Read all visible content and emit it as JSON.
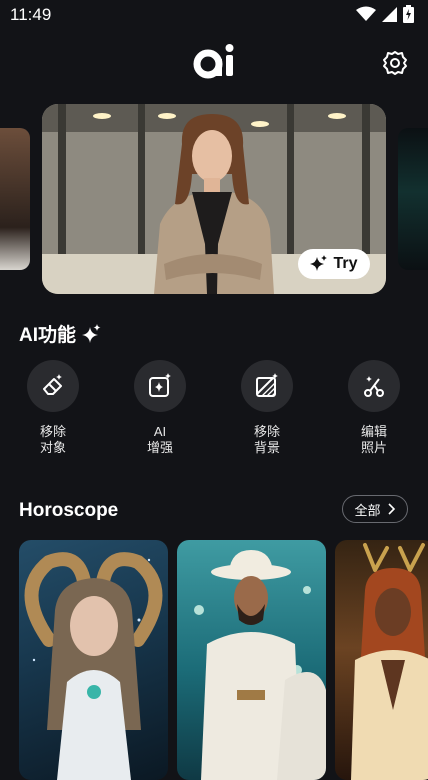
{
  "status_bar": {
    "time": "11:49"
  },
  "header": {
    "logo_text": "ai",
    "settings_icon": "gear-icon"
  },
  "banner": {
    "try_label": "Try"
  },
  "ai_features": {
    "title": "AI功能",
    "items": [
      {
        "label": "移除\n对象",
        "icon": "eraser-sparkle-icon"
      },
      {
        "label": "AI\n增强",
        "icon": "enhance-sparkle-icon"
      },
      {
        "label": "移除\n背景",
        "icon": "remove-background-icon"
      },
      {
        "label": "编辑\n照片",
        "icon": "scissors-sparkle-icon"
      }
    ]
  },
  "horoscope": {
    "title": "Horoscope",
    "all_label": "全部"
  },
  "colors": {
    "background": "#121317",
    "card": "#2a2b2f",
    "accent": "#ffffff"
  }
}
